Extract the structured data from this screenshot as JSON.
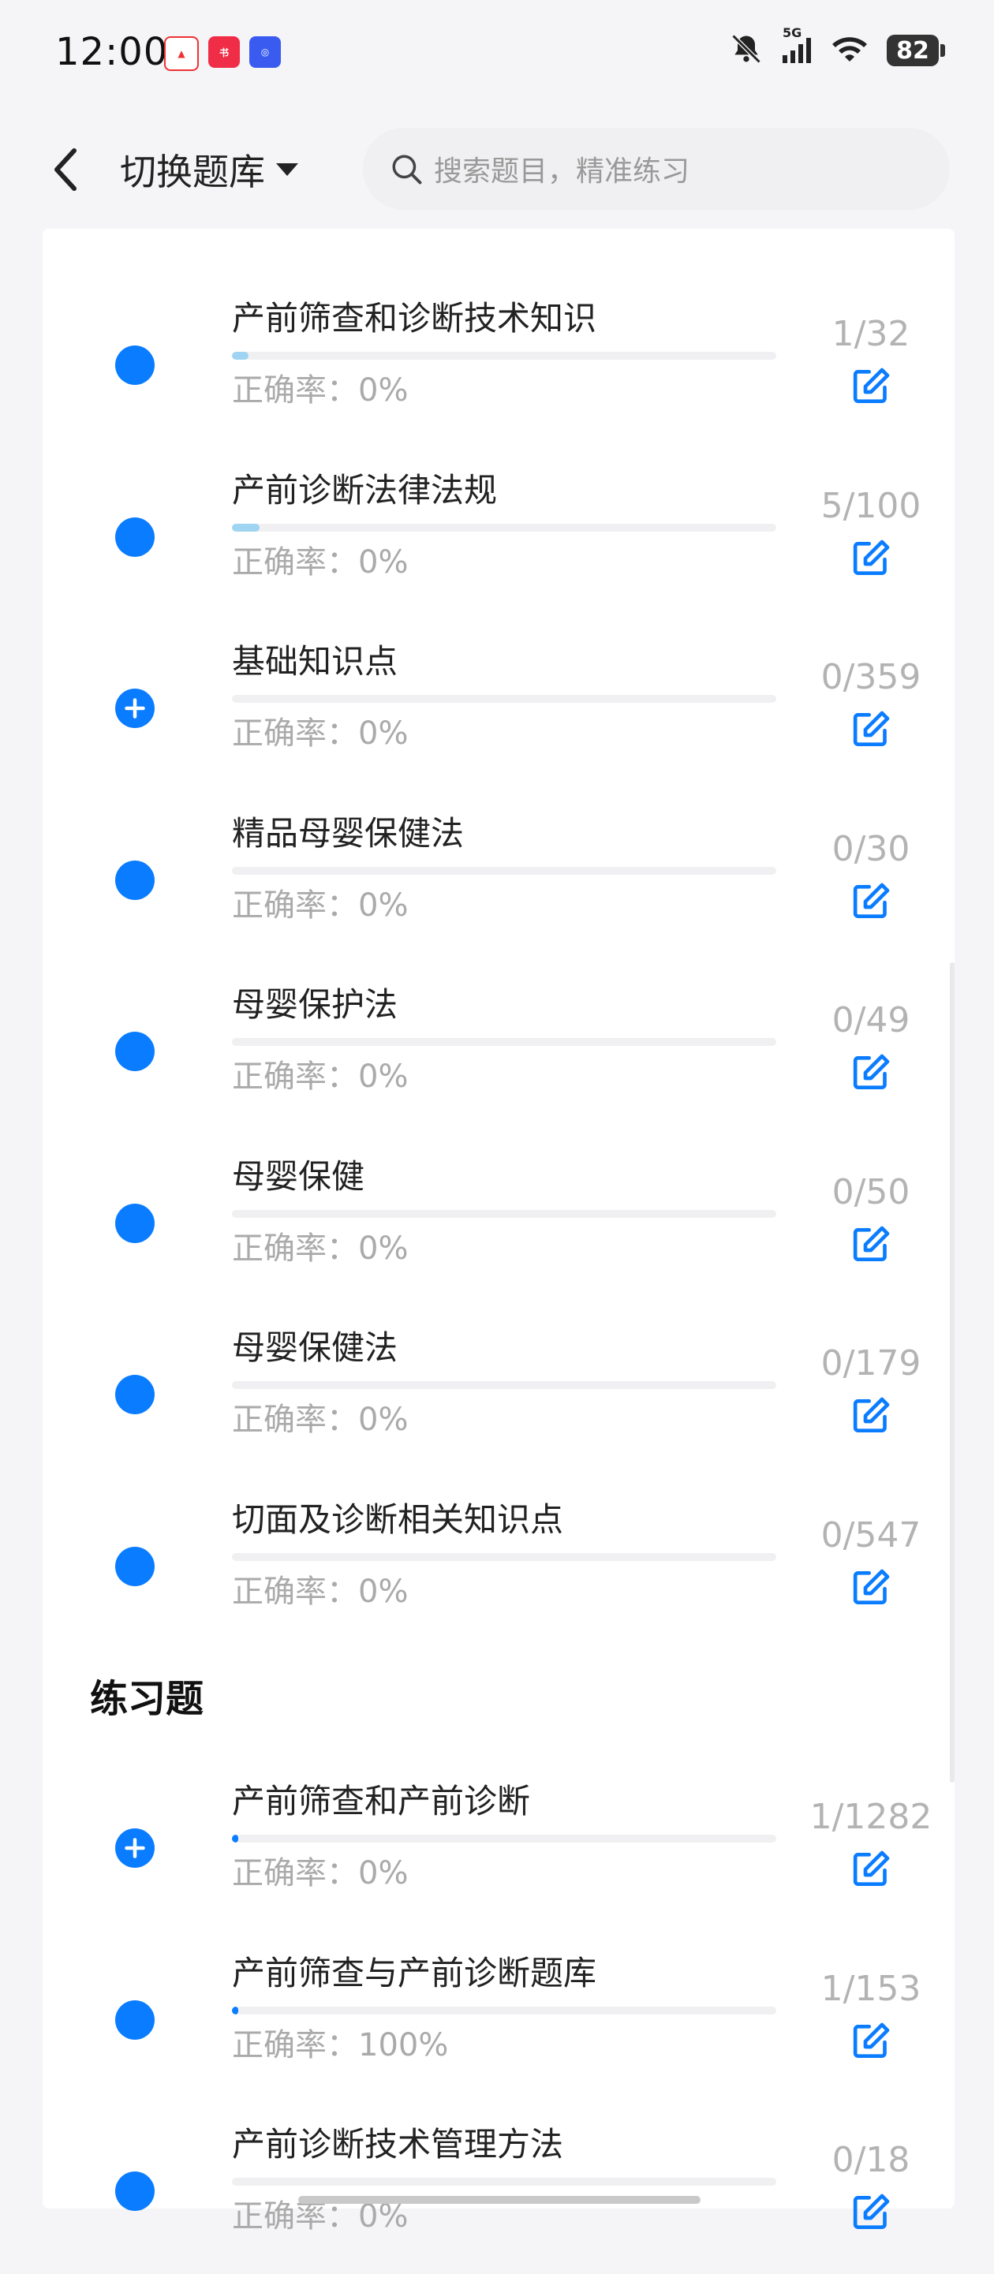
{
  "status_bar": {
    "time": "12:00",
    "battery": "82",
    "signal": "5G"
  },
  "header": {
    "switch_label": "切换题库",
    "search_placeholder": "搜索题目，精准练习"
  },
  "items_top": [
    {
      "name": "产前筛查和诊断技术知识",
      "accuracy": "正确率：0%",
      "count": "1/32",
      "progress": 0.03,
      "icon": "dot"
    },
    {
      "name": "产前诊断法律法规",
      "accuracy": "正确率：0%",
      "count": "5/100",
      "progress": 0.05,
      "icon": "dot"
    },
    {
      "name": "基础知识点",
      "accuracy": "正确率：0%",
      "count": "0/359",
      "progress": 0,
      "icon": "plus"
    },
    {
      "name": "精品母婴保健法",
      "accuracy": "正确率：0%",
      "count": "0/30",
      "progress": 0,
      "icon": "dot"
    },
    {
      "name": "母婴保护法",
      "accuracy": "正确率：0%",
      "count": "0/49",
      "progress": 0,
      "icon": "dot"
    },
    {
      "name": "母婴保健",
      "accuracy": "正确率：0%",
      "count": "0/50",
      "progress": 0,
      "icon": "dot"
    },
    {
      "name": "母婴保健法",
      "accuracy": "正确率：0%",
      "count": "0/179",
      "progress": 0,
      "icon": "dot"
    },
    {
      "name": "切面及诊断相关知识点",
      "accuracy": "正确率：0%",
      "count": "0/547",
      "progress": 0,
      "icon": "dot"
    }
  ],
  "section": {
    "title": "练习题"
  },
  "items_practice": [
    {
      "name": "产前筛查和产前诊断",
      "accuracy": "正确率：0%",
      "count": "1/1282",
      "progress": 0.001,
      "icon": "plus"
    },
    {
      "name": "产前筛查与产前诊断题库",
      "accuracy": "正确率：100%",
      "count": "1/153",
      "progress": 0.007,
      "icon": "dot"
    },
    {
      "name": "产前诊断技术管理方法",
      "accuracy": "正确率：0%",
      "count": "0/18",
      "progress": 0,
      "icon": "dot"
    }
  ],
  "colors": {
    "accent": "#0a7cff",
    "progress_fill": "#9fd4f2",
    "count_text": "#b3b3b3"
  }
}
